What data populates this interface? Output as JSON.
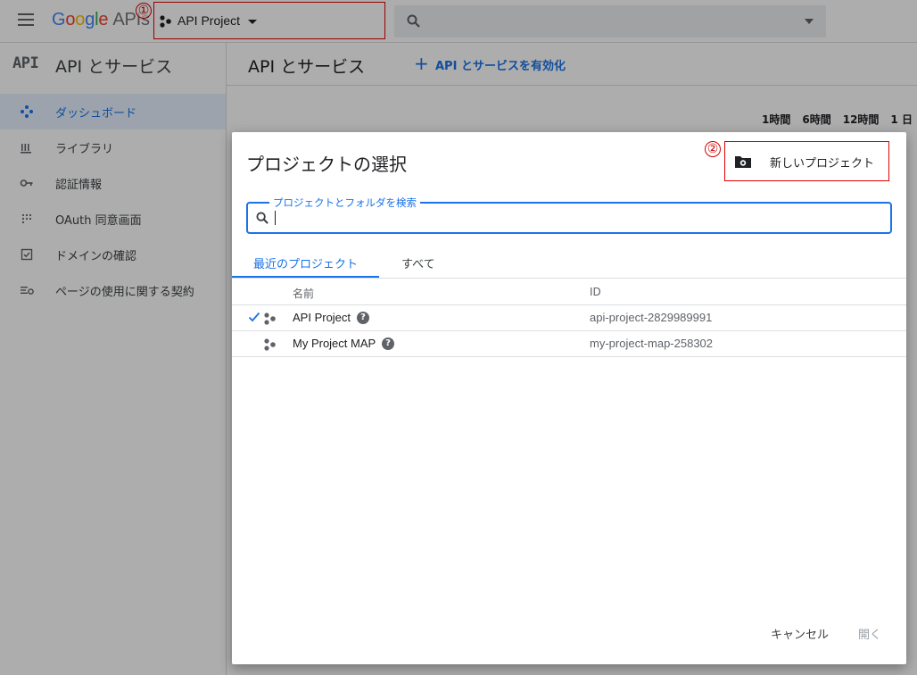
{
  "header": {
    "logo_letters": [
      "G",
      "o",
      "o",
      "g",
      "l",
      "e"
    ],
    "logo_suffix": "APIs",
    "project_selector": {
      "label": "API Project"
    },
    "markers": {
      "one": "①",
      "two": "②"
    }
  },
  "sidebar": {
    "api_mark": "API",
    "title": "API とサービス",
    "items": [
      {
        "label": "ダッシュボード",
        "icon": "dashboard-icon",
        "active": true
      },
      {
        "label": "ライブラリ",
        "icon": "library-icon",
        "active": false
      },
      {
        "label": "認証情報",
        "icon": "key-icon",
        "active": false
      },
      {
        "label": "OAuth 同意画面",
        "icon": "consent-icon",
        "active": false
      },
      {
        "label": "ドメインの確認",
        "icon": "checkbox-icon",
        "active": false
      },
      {
        "label": "ページの使用に関する契約",
        "icon": "settings-list-icon",
        "active": false
      }
    ]
  },
  "main": {
    "title": "API とサービス",
    "enable_link": "API とサービスを有効化",
    "time_ranges": [
      "1時間",
      "6時間",
      "12時間",
      "1 日"
    ]
  },
  "dialog": {
    "title": "プロジェクトの選択",
    "new_project_button": "新しいプロジェクト",
    "search": {
      "label": "プロジェクトとフォルダを検索",
      "value": ""
    },
    "tabs": [
      {
        "label": "最近のプロジェクト",
        "active": true
      },
      {
        "label": "すべて",
        "active": false
      }
    ],
    "columns": {
      "name": "名前",
      "id": "ID"
    },
    "rows": [
      {
        "name": "API Project",
        "id": "api-project-2829989991",
        "selected": true
      },
      {
        "name": "My Project MAP",
        "id": "my-project-map-258302",
        "selected": false
      }
    ],
    "cancel_button": "キャンセル",
    "open_button": "開く"
  },
  "colors": {
    "accent": "#1a73e8",
    "highlight_box": "#e00000"
  }
}
